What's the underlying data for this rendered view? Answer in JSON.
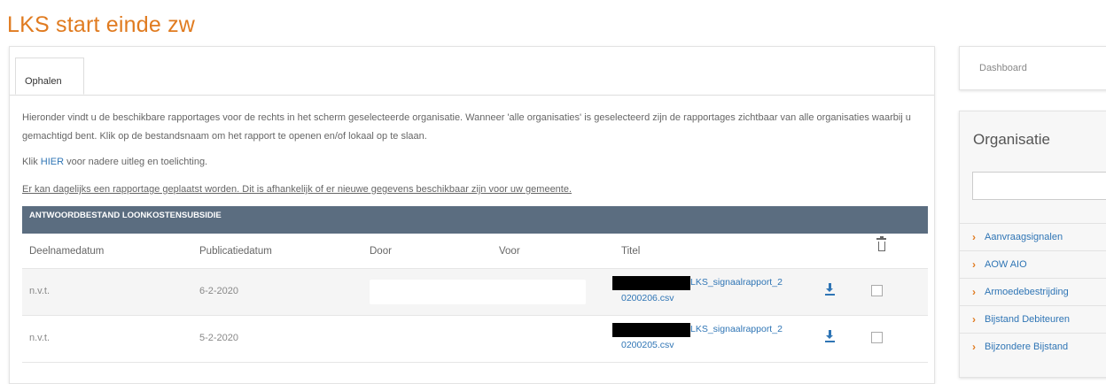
{
  "page": {
    "title": "LKS start einde zw"
  },
  "tabs": [
    {
      "label": "Ophalen"
    }
  ],
  "intro": {
    "p1": "Hieronder vindt u de beschikbare rapportages voor de rechts in het scherm geselecteerde organisatie. Wanneer 'alle organisaties' is geselecteerd zijn de rapportages zichtbaar van alle organisaties waarbij u gemachtigd bent. Klik op de bestandsnaam om het rapport te openen en/of lokaal op te slaan.",
    "p2_before": "Klik ",
    "p2_link": "HIER",
    "p2_after": " voor nadere uitleg en toelichting.",
    "p3": "Er kan dagelijks een rapportage geplaatst worden. Dit is afhankelijk of er nieuwe gegevens beschikbaar zijn voor uw gemeente."
  },
  "table": {
    "title": "ANTWOORDBESTAND LOONKOSTENSUBSIDIE",
    "columns": [
      "Deelnamedatum",
      "Publicatiedatum",
      "Door",
      "Voor",
      "Titel"
    ],
    "rows": [
      {
        "deelnamedatum": "n.v.t.",
        "publicatiedatum": "6-2-2020",
        "door": "",
        "voor": "",
        "titel_line1": "LKS_signaalrapport_2",
        "titel_line2": "0200206.csv",
        "checked": false
      },
      {
        "deelnamedatum": "n.v.t.",
        "publicatiedatum": "5-2-2020",
        "door": "",
        "voor": "",
        "titel_line1": "LKS_signaalrapport_2",
        "titel_line2": "0200205.csv",
        "checked": false
      }
    ]
  },
  "sidebar": {
    "dashboard_label": "Dashboard",
    "org_title": "Organisatie",
    "org_search_value": "",
    "items": [
      {
        "label": "Aanvraagsignalen"
      },
      {
        "label": "AOW AIO"
      },
      {
        "label": "Armoedebestrijding"
      },
      {
        "label": "Bijstand Debiteuren"
      },
      {
        "label": "Bijzondere Bijstand"
      }
    ]
  },
  "colors": {
    "accent": "#e07b20",
    "link": "#2f75b5",
    "table_header_bg": "#5b6d80"
  }
}
